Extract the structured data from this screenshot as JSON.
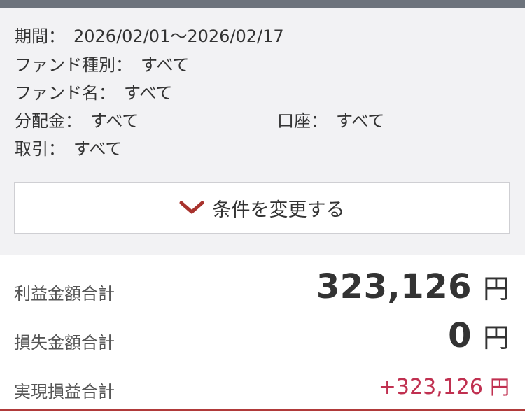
{
  "conditions": {
    "period": {
      "label": "期間：",
      "value": "2026/02/01〜2026/02/17"
    },
    "fund_type": {
      "label": "ファンド種別：",
      "value": "すべて"
    },
    "fund_name": {
      "label": "ファンド名：",
      "value": "すべて"
    },
    "distribution": {
      "label": "分配金：",
      "value": "すべて"
    },
    "account": {
      "label": "口座：",
      "value": "すべて"
    },
    "transaction": {
      "label": "取引：",
      "value": "すべて"
    }
  },
  "change_button": {
    "label": "条件を変更する",
    "icon": "chevron-down-icon",
    "icon_color": "#a8322d"
  },
  "summary": {
    "profit": {
      "label": "利益金額合計",
      "value": "323,126",
      "unit": "円"
    },
    "loss": {
      "label": "損失金額合計",
      "value": "0",
      "unit": "円"
    },
    "realized": {
      "label": "実現損益合計",
      "value": "+323,126",
      "unit": "円",
      "color": "#c03050"
    }
  }
}
